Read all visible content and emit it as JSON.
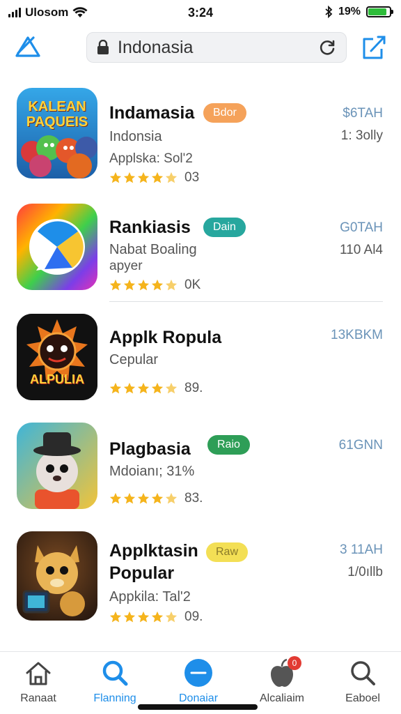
{
  "status_bar": {
    "carrier": "Ulosom",
    "time": "3:24",
    "battery_percent": "19%",
    "battery_level": 0.85
  },
  "header": {
    "search_text": "Indonasia"
  },
  "apps": [
    {
      "name": "Indamasia",
      "badge": "Bdor",
      "badge_color": "#f5a25a",
      "subtitle": "Indonsia",
      "subtitle2": "Applska: Sol'2",
      "rating_text": "03",
      "meta_top": "$6TAH",
      "meta_bottom": "1: 3olly",
      "icon_text_top": "KALEAN",
      "icon_text_bottom": "PAQUEIS"
    },
    {
      "name": "Rankiasis",
      "badge": "Dain",
      "badge_color": "#27a79e",
      "subtitle": "Nabat Boaling",
      "subtitle2": "apyer",
      "rating_text": "0K",
      "meta_top": "G0TAH",
      "meta_bottom": "110 Al4"
    },
    {
      "name": "Applk Ropula",
      "subtitle": "Cepular",
      "rating_text": "89.",
      "meta_top": "13KBKM",
      "icon_text": "ALPULIA"
    },
    {
      "name": "Plagbasia",
      "badge": "Raio",
      "badge_color": "#2e9e57",
      "subtitle": "Mdoianı; 31%",
      "rating_text": "83.",
      "meta_top": "61GNN"
    },
    {
      "name": "Applktasin",
      "name_line2": "Popular",
      "badge": "Raw",
      "badge_color": "#f3df55",
      "subtitle": "Appkila: Tal'2",
      "rating_text": "09.",
      "meta_top": "3 11AH",
      "meta_bottom": "1/0ıllb"
    }
  ],
  "tabs": [
    {
      "label": "Ranaat",
      "icon": "home-icon"
    },
    {
      "label": "Flanning",
      "icon": "search-icon"
    },
    {
      "label": "Donaiar",
      "icon": "toggle-icon"
    },
    {
      "label": "Alcaliaim",
      "icon": "apple-icon",
      "badge": "0"
    },
    {
      "label": "Eaboel",
      "icon": "search-icon"
    }
  ],
  "colors": {
    "accent": "#1e8ee9",
    "star": "#f5b41c",
    "meta": "#6a93b8"
  }
}
